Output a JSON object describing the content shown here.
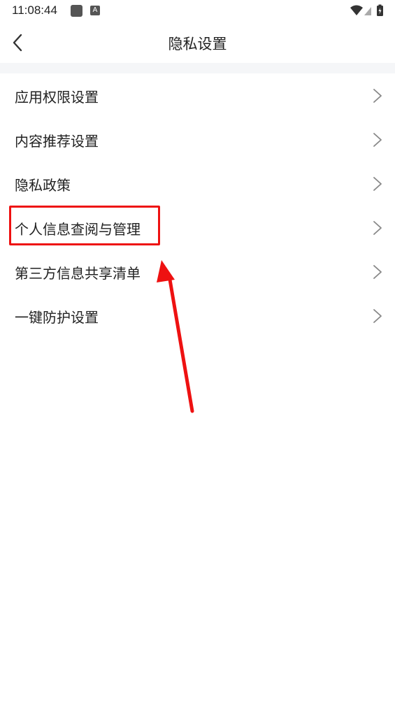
{
  "status_bar": {
    "time": "11:08:44",
    "app_badge": "A",
    "icons": [
      "app-notification-icon",
      "a-badge-icon",
      "wifi-icon",
      "cell-signal-icon",
      "battery-charging-icon"
    ]
  },
  "header": {
    "title": "隐私设置",
    "back_icon": "chevron-left-icon"
  },
  "list": {
    "items": [
      {
        "label": "应用权限设置"
      },
      {
        "label": "内容推荐设置"
      },
      {
        "label": "隐私政策"
      },
      {
        "label": "个人信息查阅与管理"
      },
      {
        "label": "第三方信息共享清单"
      },
      {
        "label": "一键防护设置"
      }
    ]
  },
  "annotation": {
    "highlight_color": "#ee1111",
    "highlighted_item": "个人信息查阅与管理"
  }
}
